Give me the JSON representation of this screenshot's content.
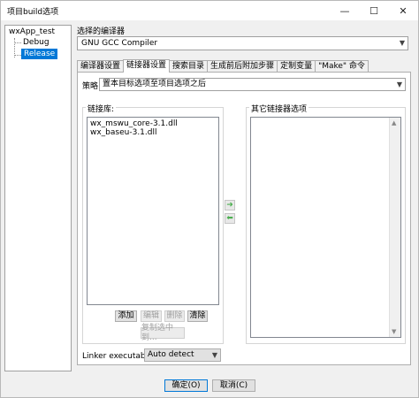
{
  "window": {
    "title": "项目build选项",
    "minimize": "—",
    "maximize": "☐",
    "close": "✕"
  },
  "tree": {
    "root": "wxApp_test",
    "children": [
      "Debug",
      "Release"
    ],
    "selected": "Release"
  },
  "compiler": {
    "label": "选择的编译器",
    "value": "GNU GCC Compiler"
  },
  "tabs": [
    "编译器设置",
    "链接器设置",
    "搜索目录",
    "生成前后附加步骤",
    "定制变量",
    "\"Make\" 命令"
  ],
  "active_tab": "链接器设置",
  "policy": {
    "label": "策略:",
    "value": "置本目标选项至项目选项之后"
  },
  "libs": {
    "title": "链接库:",
    "items": [
      "wx_mswu_core-3.1.dll",
      "wx_baseu-3.1.dll"
    ],
    "buttons": {
      "add": "添加",
      "edit": "编辑",
      "delete": "删除",
      "clear": "清除",
      "copy": "复制选中到..."
    }
  },
  "other": {
    "title": "其它链接器选项"
  },
  "linker": {
    "label": "Linker executable:",
    "value": "Auto detect"
  },
  "footer": {
    "ok": "确定(O)",
    "cancel": "取消(C)"
  },
  "icons": {
    "arrow_right": "arrow-right-icon",
    "arrow_left": "arrow-left-icon",
    "dropdown": "chevron-down-icon"
  },
  "colors": {
    "selection": "#0078d7",
    "arrow": "#4caf50"
  }
}
